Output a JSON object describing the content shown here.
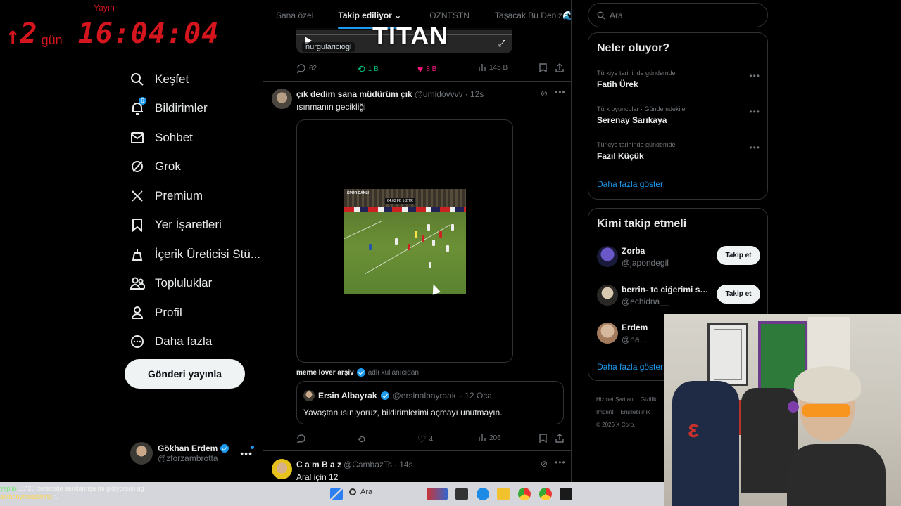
{
  "overlay": {
    "yayin": "Yayın",
    "arrow": "↑",
    "days": "2",
    "days_unit": "gün",
    "clock": "16:04:04"
  },
  "nav": {
    "items": [
      {
        "label": "Keşfet",
        "icon": "search-icon"
      },
      {
        "label": "Bildirimler",
        "icon": "bell-icon",
        "badge": "6"
      },
      {
        "label": "Sohbet",
        "icon": "envelope-icon"
      },
      {
        "label": "Grok",
        "icon": "grok-icon"
      },
      {
        "label": "Premium",
        "icon": "x-logo-icon"
      },
      {
        "label": "Yer İşaretleri",
        "icon": "bookmark-icon"
      },
      {
        "label": "İçerik Üreticisi Stü...",
        "icon": "creator-icon"
      },
      {
        "label": "Topluluklar",
        "icon": "people-icon"
      },
      {
        "label": "Profil",
        "icon": "person-icon"
      },
      {
        "label": "Daha fazla",
        "icon": "more-circle-icon"
      }
    ],
    "post_button": "Gönderi yayınla"
  },
  "account": {
    "name": "Gökhan Erdem",
    "handle": "@zforzambrotta",
    "more": "•••"
  },
  "tabs": [
    {
      "label": "Sana özel"
    },
    {
      "label": "Takip ediliyor",
      "active": true
    },
    {
      "label": "OZNTSTN"
    },
    {
      "label": "Taşacak Bu Deniz🌊"
    }
  ],
  "stream_logo": "TITAN",
  "top_video": {
    "user": "nurgulariciogl"
  },
  "top_actions": {
    "replies": "62",
    "reposts": "1 B",
    "likes": "8 B",
    "views": "145 B"
  },
  "tweet1": {
    "name": "çık dedim sana müdürüm çık",
    "handle": "@umidovvvv",
    "time": "· 12s",
    "text": "ısınmanın gecikliği",
    "video": {
      "scoreboard": "64:03  FB 1-2 TR",
      "channel": "SPOR CANLI"
    },
    "attribution_name": "meme lover arşiv",
    "attribution_suffix": "adlı kullanıcıdan",
    "quote": {
      "name": "Ersin Albayrak",
      "handle": "@ersinalbayraak",
      "time": "· 12 Oca",
      "text": "Yavaştan ısınıyoruz, bildirimlerimi açmayı unutmayın."
    },
    "actions": {
      "replies": "",
      "reposts": "",
      "likes": "4",
      "views": "206"
    }
  },
  "tweet2": {
    "name": "C a m B a z",
    "handle": "@CambazTs",
    "time": "· 14s",
    "text": "Aral için 12"
  },
  "search": {
    "placeholder": "Ara"
  },
  "trends": {
    "title": "Neler oluyor?",
    "items": [
      {
        "context": "Türkiye tarihinde gündemde",
        "title": "Fatih Ürek"
      },
      {
        "context": "Türk oyuncular · Gündemdekiler",
        "title": "Serenay Sarıkaya"
      },
      {
        "context": "Türkiye tarihinde gündemde",
        "title": "Fazıl Küçük"
      }
    ],
    "more": "Daha fazla göster"
  },
  "who_to_follow": {
    "title": "Kimi takip etmeli",
    "items": [
      {
        "name": "Zorba",
        "handle": "@japondegil",
        "button": "Takip et"
      },
      {
        "name": "berrin- tc ciğerimi so...",
        "handle": "@echidna__",
        "button": "Takip et"
      },
      {
        "name": "Erdem",
        "handle": "@na...",
        "button": ""
      }
    ],
    "more": "Daha fazla göster"
  },
  "footer": {
    "links": [
      "Hizmet Şartları",
      "Gizlilik",
      "Imprint",
      "Erişilebilirlik"
    ],
    "copyright": "© 2026 X Corp."
  },
  "chat": {
    "line1_user": "yeplio",
    "line1_msg": "15*20 derecede sarıkamışa mı gidiyorsun ag",
    "line2_user": "anthonyronaldinho",
    "line2_msg": ":."
  },
  "taskbar": {
    "search_label": "Ara"
  }
}
